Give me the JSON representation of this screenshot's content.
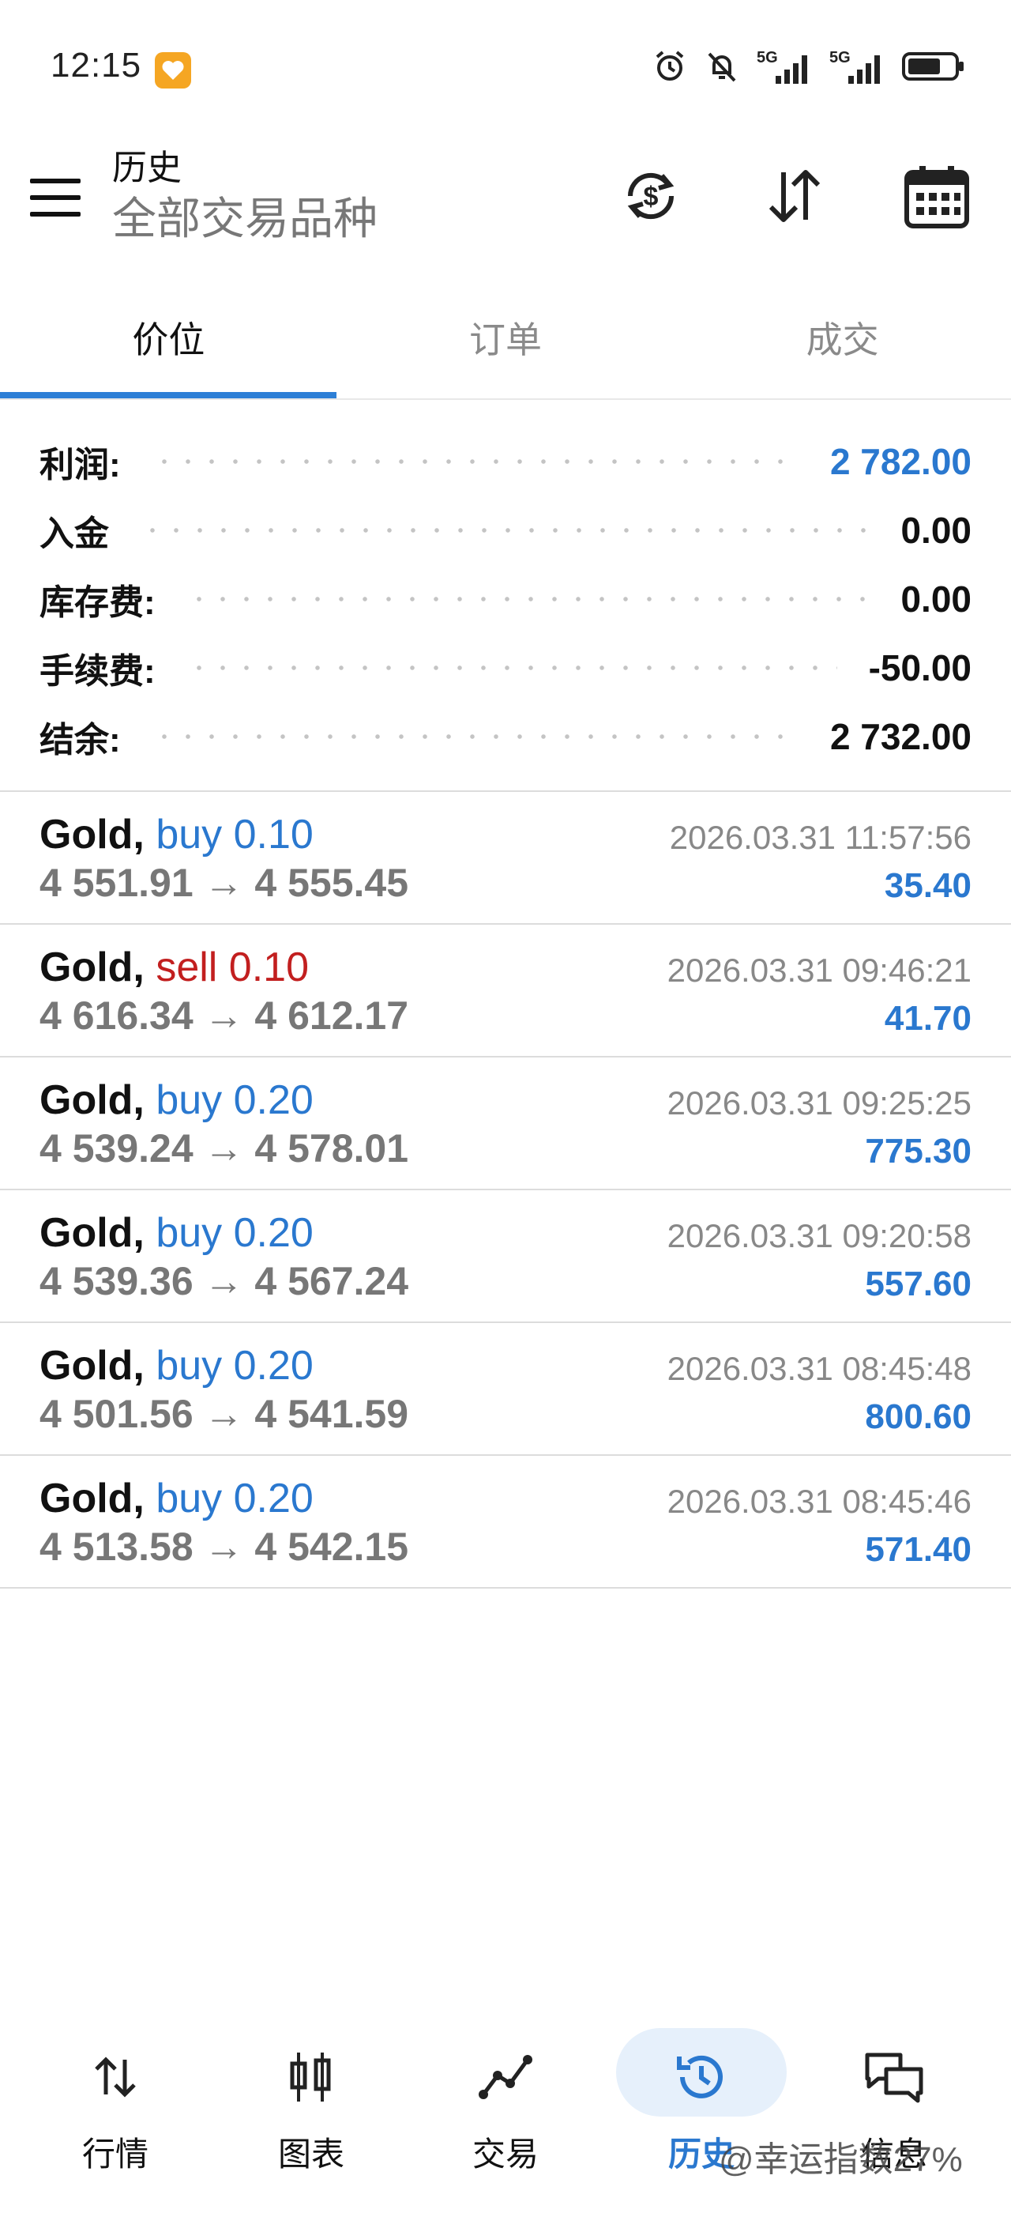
{
  "status_bar": {
    "time": "12:15",
    "network_1": "5G",
    "network_2": "5G"
  },
  "header": {
    "title": "历史",
    "subtitle": "全部交易品种"
  },
  "tabs": [
    {
      "label": "价位",
      "active": true
    },
    {
      "label": "订单",
      "active": false
    },
    {
      "label": "成交",
      "active": false
    }
  ],
  "summary": [
    {
      "label": "利润:",
      "value": "2 782.00"
    },
    {
      "label": "入金",
      "value": "0.00"
    },
    {
      "label": "库存费:",
      "value": "0.00"
    },
    {
      "label": "手续费:",
      "value": "-50.00"
    },
    {
      "label": "结余:",
      "value": "2 732.00"
    }
  ],
  "deals": [
    {
      "symbol": "Gold,",
      "side": "buy 0.10",
      "type": "buy",
      "prices": "4 551.91 → 4 555.45",
      "time": "2026.03.31 11:57:56",
      "profit": "35.40"
    },
    {
      "symbol": "Gold,",
      "side": "sell 0.10",
      "type": "sell",
      "prices": "4 616.34 → 4 612.17",
      "time": "2026.03.31 09:46:21",
      "profit": "41.70"
    },
    {
      "symbol": "Gold,",
      "side": "buy 0.20",
      "type": "buy",
      "prices": "4 539.24 → 4 578.01",
      "time": "2026.03.31 09:25:25",
      "profit": "775.30"
    },
    {
      "symbol": "Gold,",
      "side": "buy 0.20",
      "type": "buy",
      "prices": "4 539.36 → 4 567.24",
      "time": "2026.03.31 09:20:58",
      "profit": "557.60"
    },
    {
      "symbol": "Gold,",
      "side": "buy 0.20",
      "type": "buy",
      "prices": "4 501.56 → 4 541.59",
      "time": "2026.03.31 08:45:48",
      "profit": "800.60"
    },
    {
      "symbol": "Gold,",
      "side": "buy 0.20",
      "type": "buy",
      "prices": "4 513.58 → 4 542.15",
      "time": "2026.03.31 08:45:46",
      "profit": "571.40"
    }
  ],
  "bottom_nav": [
    {
      "label": "行情",
      "icon": "arrows-up-down-icon",
      "active": false
    },
    {
      "label": "图表",
      "icon": "candlestick-icon",
      "active": false
    },
    {
      "label": "交易",
      "icon": "trade-line-icon",
      "active": false
    },
    {
      "label": "历史",
      "icon": "history-clock-icon",
      "active": true
    },
    {
      "label": "信息",
      "icon": "chat-bubbles-icon",
      "active": false
    }
  ],
  "watermark": "@幸运指数27%",
  "colors": {
    "accent": "#2a78cf",
    "sell": "#c21f1f",
    "muted": "#777777"
  }
}
